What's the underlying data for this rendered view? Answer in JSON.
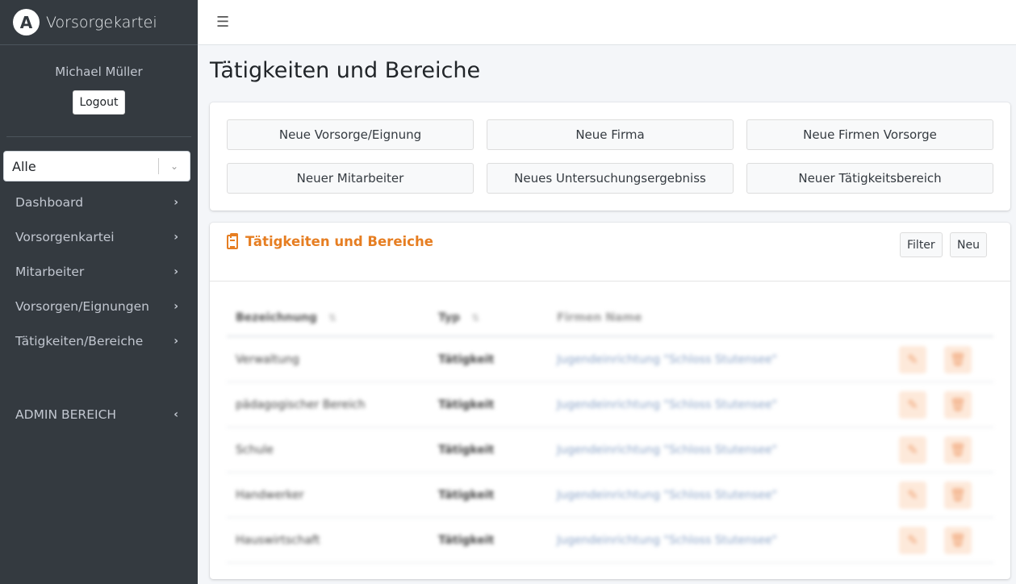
{
  "brand": {
    "name": "Vorsorgekartei",
    "logo_letter": "A"
  },
  "user": {
    "name": "Michael Müller",
    "logout_label": "Logout"
  },
  "filter_select": {
    "value": "Alle"
  },
  "nav": [
    {
      "label": "Dashboard"
    },
    {
      "label": "Vorsorgenkartei"
    },
    {
      "label": "Mitarbeiter"
    },
    {
      "label": "Vorsorgen/Eignungen"
    },
    {
      "label": "Tätigkeiten/Bereiche"
    }
  ],
  "admin_nav": {
    "label": "ADMIN BEREICH"
  },
  "page": {
    "title": "Tätigkeiten und Bereiche"
  },
  "actions": [
    "Neue Vorsorge/Eignung",
    "Neue Firma",
    "Neue Firmen Vorsorge",
    "Neuer Mitarbeiter",
    "Neues Untersuchungsergebniss",
    "Neuer Tätigkeitsbereich"
  ],
  "table_card": {
    "title": "Tätigkeiten und Bereiche",
    "filter_label": "Filter",
    "new_label": "Neu",
    "columns": [
      "Bezeichnung",
      "Typ",
      "Firmen Name"
    ],
    "rows": [
      {
        "name": "Verwaltung",
        "type": "Tätigkeit",
        "company": "Jugendeinrichtung \"Schloss Stutensee\""
      },
      {
        "name": "pädagogischer Bereich",
        "type": "Tätigkeit",
        "company": "Jugendeinrichtung \"Schloss Stutensee\""
      },
      {
        "name": "Schule",
        "type": "Tätigkeit",
        "company": "Jugendeinrichtung \"Schloss Stutensee\""
      },
      {
        "name": "Handwerker",
        "type": "Tätigkeit",
        "company": "Jugendeinrichtung \"Schloss Stutensee\""
      },
      {
        "name": "Hauswirtschaft",
        "type": "Tätigkeit",
        "company": "Jugendeinrichtung \"Schloss Stutensee\""
      }
    ]
  },
  "colors": {
    "sidebar": "#343a40",
    "accent": "#e67e22",
    "content_bg": "#f4f6f9"
  }
}
